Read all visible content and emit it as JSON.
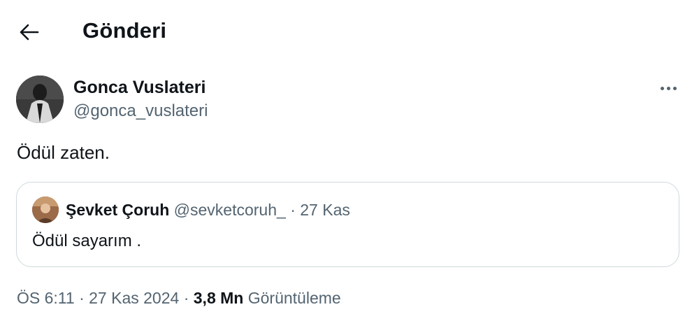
{
  "header": {
    "title": "Gönderi",
    "back_icon": "arrow-left-icon"
  },
  "tweet": {
    "display_name": "Gonca Vuslateri",
    "handle": "@gonca_vuslateri",
    "more_icon": "more-horizontal-icon",
    "text": "Ödül zaten.",
    "quote": {
      "display_name": "Şevket Çoruh",
      "handle": "@sevketcoruh_",
      "separator": "·",
      "date": "27 Kas",
      "text": "Ödül sayarım ."
    },
    "meta": {
      "time": "ÖS 6:11",
      "sep1": "·",
      "date": "27 Kas 2024",
      "sep2": "·",
      "views_count": "3,8 Mn",
      "views_label": "Görüntüleme"
    }
  },
  "colors": {
    "text_primary": "#0f1419",
    "text_secondary": "#536471",
    "border": "#cfd9de"
  }
}
